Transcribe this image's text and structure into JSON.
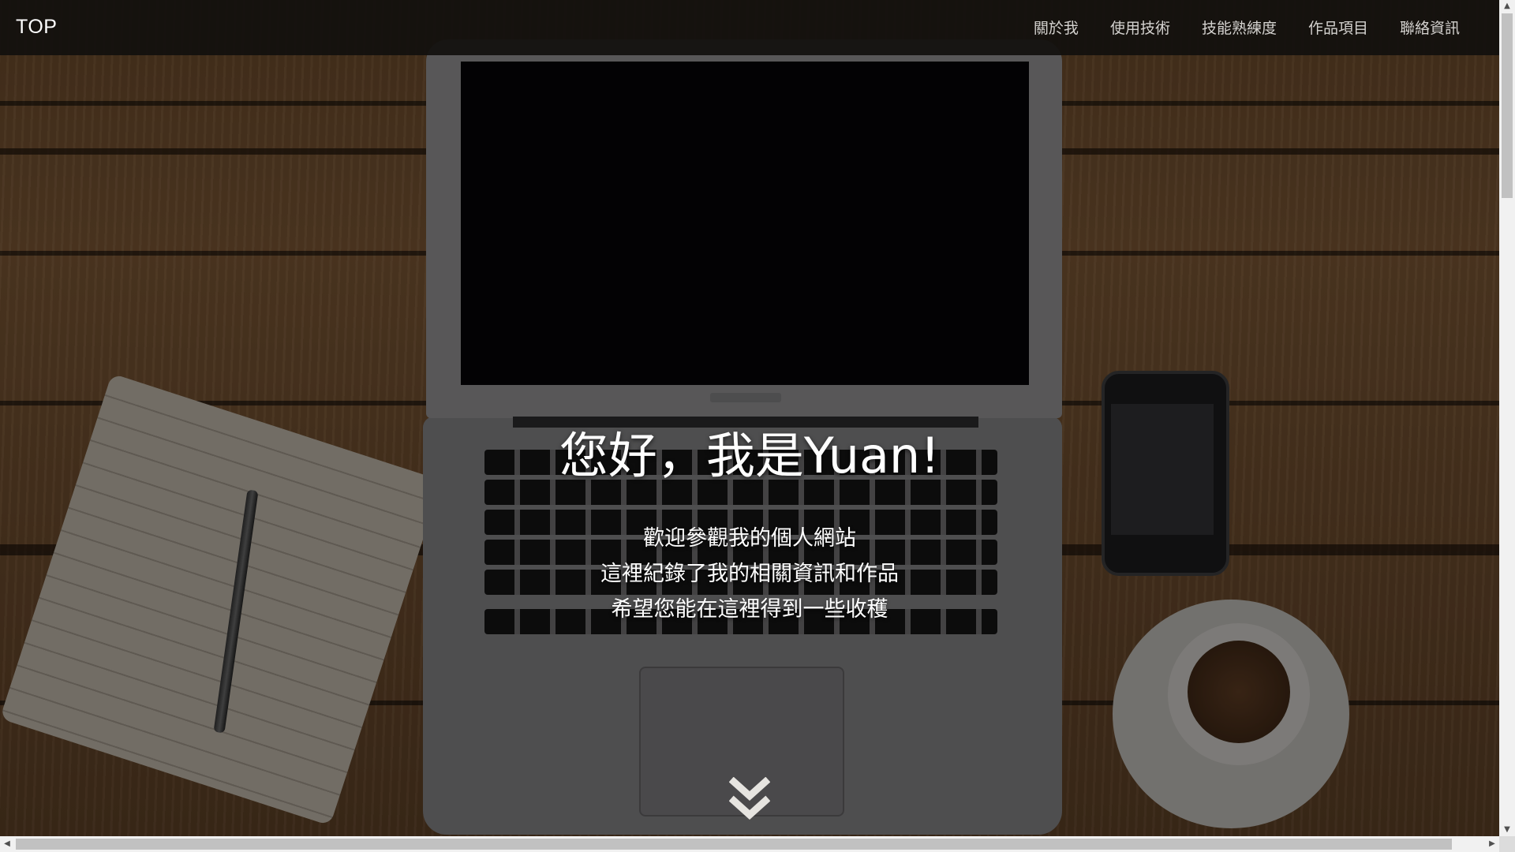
{
  "navbar": {
    "brand": "TOP",
    "links": [
      {
        "label": "關於我"
      },
      {
        "label": "使用技術"
      },
      {
        "label": "技能熟練度"
      },
      {
        "label": "作品項目"
      },
      {
        "label": "聯絡資訊"
      }
    ]
  },
  "hero": {
    "title": "您好，我是Yuan!",
    "lines": [
      "歡迎參觀我的個人網站",
      "這裡紀錄了我的相關資訊和作品",
      "希望您能在這裡得到一些收穫"
    ],
    "scroll_icon": "double-chevron-down-icon"
  },
  "scrollbars": {
    "up_icon": "▲",
    "down_icon": "▼",
    "left_icon": "◀",
    "right_icon": "▶"
  },
  "colors": {
    "navbar_bg": "#12100e",
    "nav_text": "#d4d2cf",
    "hero_text": "#ffffff"
  }
}
